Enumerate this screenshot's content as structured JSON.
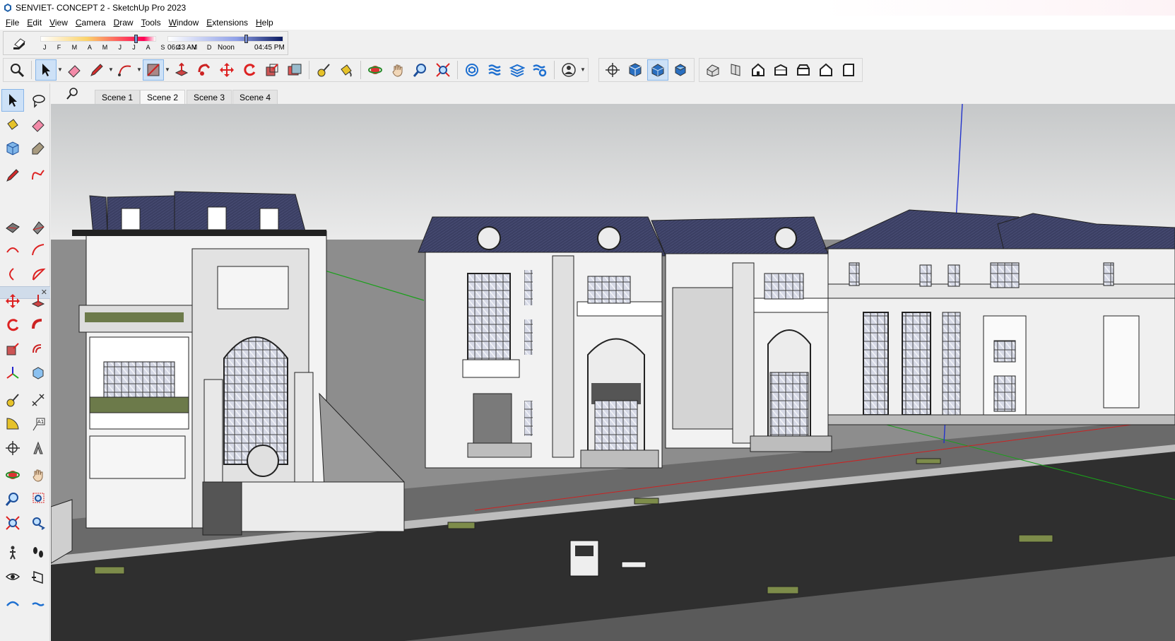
{
  "window": {
    "title": "SENVIET- CONCEPT 2 - SketchUp Pro 2023"
  },
  "menu": [
    {
      "label": "File",
      "name": "menu-file"
    },
    {
      "label": "Edit",
      "name": "menu-edit"
    },
    {
      "label": "View",
      "name": "menu-view"
    },
    {
      "label": "Camera",
      "name": "menu-camera"
    },
    {
      "label": "Draw",
      "name": "menu-draw"
    },
    {
      "label": "Tools",
      "name": "menu-tools"
    },
    {
      "label": "Window",
      "name": "menu-window"
    },
    {
      "label": "Extensions",
      "name": "menu-extensions"
    },
    {
      "label": "Help",
      "name": "menu-help"
    }
  ],
  "shadows": {
    "months_label": "J F M A M J J A S O N D",
    "time_start": "06:43 AM",
    "time_noon": "Noon",
    "time_end": "04:45 PM",
    "month_position": 0.83,
    "time_position": 0.68
  },
  "scenes": [
    {
      "label": "Scene 1",
      "selected": false
    },
    {
      "label": "Scene 2",
      "selected": true
    },
    {
      "label": "Scene 3",
      "selected": false
    },
    {
      "label": "Scene 4",
      "selected": false
    }
  ],
  "toolbar": {
    "active_tool": "select-tool",
    "active_view": "iso-view"
  },
  "colors": {
    "sky_top": "#c9cbcc",
    "sky_bottom": "#e9e9e9",
    "ground": "#8d8d8d",
    "road": "#2f2f2f",
    "roof": "#3b3f63",
    "wall": "#f3f3f3",
    "axis_blue": "#2233cc",
    "axis_green": "#1aa01a",
    "axis_red": "#cc2222"
  }
}
